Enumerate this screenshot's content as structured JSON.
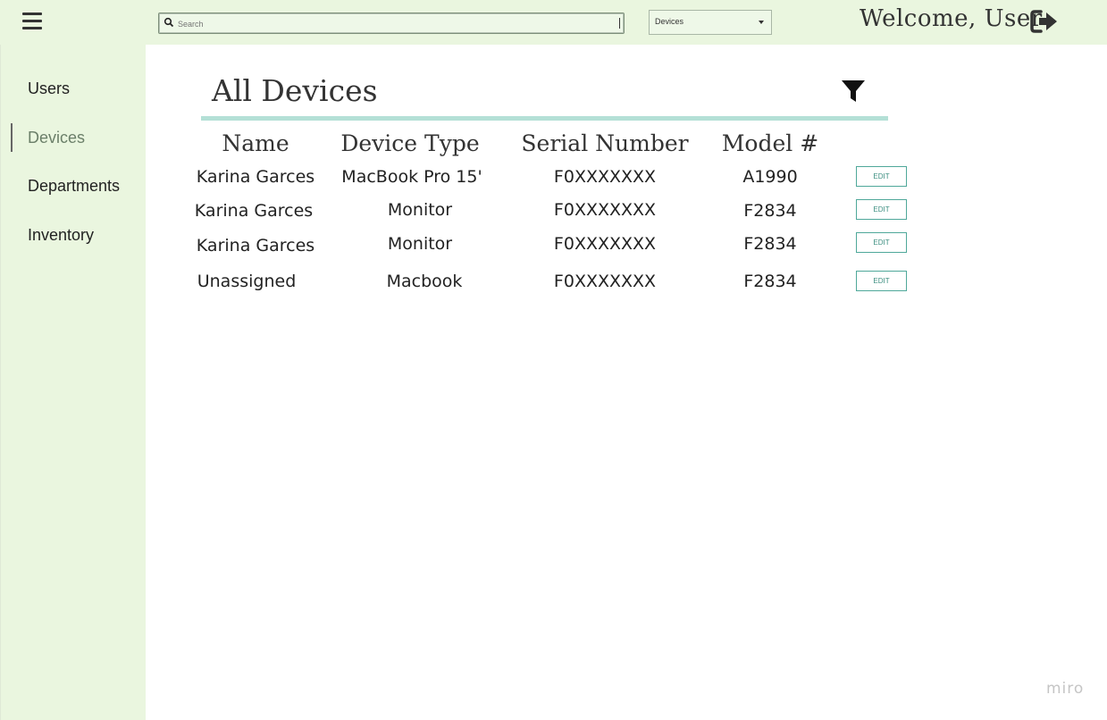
{
  "header": {
    "search_placeholder": "Search",
    "category_select": "Devices",
    "welcome_text": "Welcome, User"
  },
  "sidebar": {
    "items": [
      {
        "label": "Users"
      },
      {
        "label": "Devices"
      },
      {
        "label": "Departments"
      },
      {
        "label": "Inventory"
      }
    ]
  },
  "main": {
    "title": "All Devices",
    "columns": [
      "Name",
      "Device Type",
      "Serial Number",
      "Model #"
    ],
    "rows": [
      {
        "name": "Karina Garces",
        "device_type": "MacBook Pro 15'",
        "serial": "F0XXXXXXX",
        "model": "A1990",
        "action": "EDIT"
      },
      {
        "name": "Karina Garces",
        "device_type": "Monitor",
        "serial": "F0XXXXXXX",
        "model": "F2834",
        "action": "EDIT"
      },
      {
        "name": "Karina Garces",
        "device_type": "Monitor",
        "serial": "F0XXXXXXX",
        "model": "F2834",
        "action": "EDIT"
      },
      {
        "name": "Unassigned",
        "device_type": "Macbook",
        "serial": "F0XXXXXXX",
        "model": "F2834",
        "action": "EDIT"
      }
    ]
  },
  "footer": {
    "brand": "miro"
  },
  "icons": {
    "menu": "hamburger-icon",
    "search": "magnifier-icon",
    "dropdown": "caret-down-icon",
    "logout": "sign-out-icon",
    "filter": "funnel-icon"
  },
  "colors": {
    "chrome_background": "#eaf6df",
    "divider": "#b4e0d6",
    "edit_button": "#4fa89a",
    "active_nav": "#6b7f69"
  }
}
